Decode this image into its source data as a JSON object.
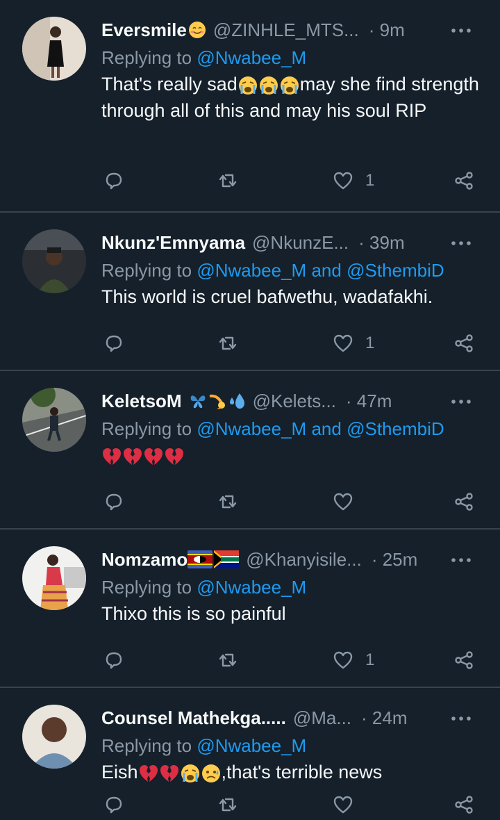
{
  "colors": {
    "background": "#15202b",
    "divider": "#38444d",
    "text": "#f7f9f9",
    "muted": "#8b98a5",
    "link": "#1d9bf0"
  },
  "replying_to_prefix": "Replying to",
  "tweets": [
    {
      "display_name": "Eversmile",
      "name_emojis": [
        "smiling-face-emoji"
      ],
      "handle": "@ZINHLE_MTS...",
      "time": "· 9m",
      "mentions": [
        "@Nwabee_M"
      ],
      "text_parts": [
        "That's really sad",
        "may she find strength through all of this and may his soul RIP"
      ],
      "text_emojis": [
        "crying-face-emoji",
        "crying-face-emoji",
        "crying-face-emoji"
      ],
      "like_count": "1"
    },
    {
      "display_name": "Nkunz'Emnyama",
      "name_emojis": [],
      "handle": "@NkunzE...",
      "time": "· 39m",
      "mentions": [
        "@Nwabee_M",
        "@SthembiD"
      ],
      "mention_joiner": "and",
      "text": "This world is cruel bafwethu, wadafakhi.",
      "like_count": "1"
    },
    {
      "display_name": "KeletsoM",
      "name_emojis": [
        "butterfly-emoji",
        "comet-emoji",
        "droplets-emoji"
      ],
      "handle": "@Kelets...",
      "time": "· 47m",
      "mentions": [
        "@Nwabee_M",
        "@SthembiD"
      ],
      "mention_joiner": "and",
      "text_emojis": [
        "broken-heart-emoji",
        "broken-heart-emoji",
        "broken-heart-emoji",
        "broken-heart-emoji"
      ],
      "like_count": ""
    },
    {
      "display_name": "Nomzamo",
      "name_emojis": [
        "eswatini-flag-emoji",
        "south-africa-flag-emoji"
      ],
      "handle": "@Khanyisile...",
      "time": "· 25m",
      "mentions": [
        "@Nwabee_M"
      ],
      "text": "Thixo this is so painful",
      "like_count": "1"
    },
    {
      "display_name": "Counsel Mathekga.....",
      "name_emojis": [],
      "handle": "@Ma...",
      "time": "· 24m",
      "mentions": [
        "@Nwabee_M"
      ],
      "text_parts": [
        "Eish",
        ",that's terrible news"
      ],
      "text_emojis": [
        "broken-heart-emoji",
        "broken-heart-emoji",
        "crying-face-emoji",
        "sad-relieved-face-emoji"
      ],
      "like_count": ""
    }
  ]
}
